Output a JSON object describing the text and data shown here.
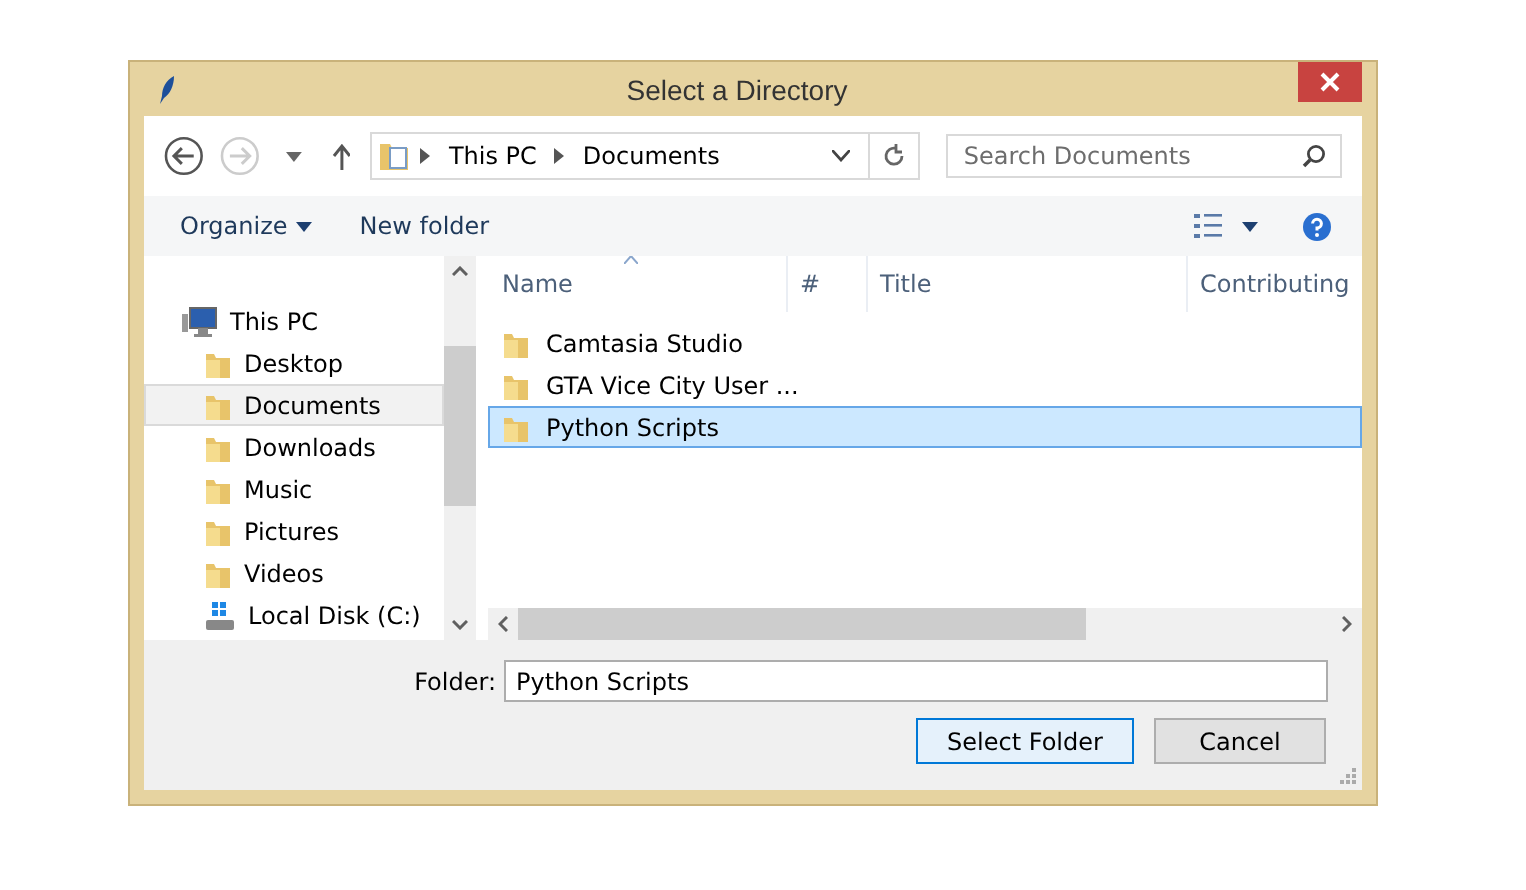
{
  "window": {
    "title": "Select a Directory"
  },
  "address": {
    "segments": [
      "This PC",
      "Documents"
    ]
  },
  "search": {
    "placeholder": "Search Documents"
  },
  "toolbar": {
    "organize": "Organize",
    "new_folder": "New folder"
  },
  "sidebar": {
    "items": [
      {
        "label": "This PC",
        "kind": "computer",
        "selected": false,
        "children": [
          {
            "label": "Desktop",
            "kind": "folder",
            "selected": false
          },
          {
            "label": "Documents",
            "kind": "folder",
            "selected": true
          },
          {
            "label": "Downloads",
            "kind": "folder",
            "selected": false
          },
          {
            "label": "Music",
            "kind": "folder",
            "selected": false
          },
          {
            "label": "Pictures",
            "kind": "folder",
            "selected": false
          },
          {
            "label": "Videos",
            "kind": "folder",
            "selected": false
          },
          {
            "label": "Local Disk (C:)",
            "kind": "drive",
            "selected": false
          }
        ]
      }
    ]
  },
  "table": {
    "columns": [
      "Name",
      "#",
      "Title",
      "Contributing"
    ],
    "rows": [
      {
        "name": "Camtasia Studio",
        "selected": false
      },
      {
        "name": "GTA Vice City User ...",
        "selected": false
      },
      {
        "name": "Python Scripts",
        "selected": true
      }
    ]
  },
  "folder_field": {
    "label": "Folder:",
    "value": "Python Scripts"
  },
  "buttons": [
    {
      "label": "Select Folder",
      "default": true
    },
    {
      "label": "Cancel",
      "default": false
    }
  ]
}
